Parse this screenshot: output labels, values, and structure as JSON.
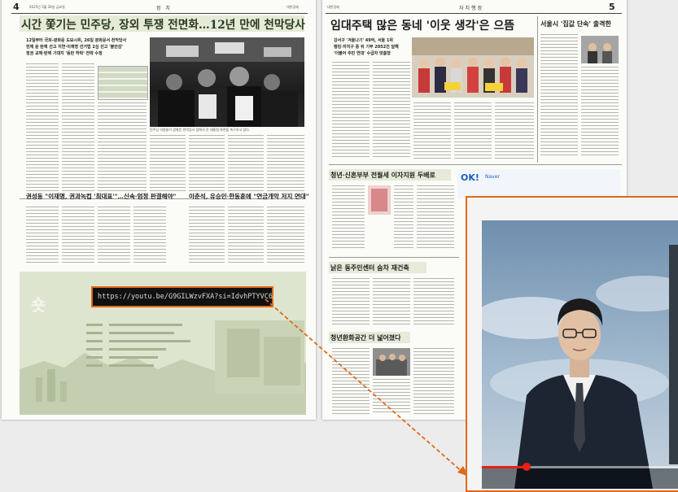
{
  "left_page": {
    "page_number": "4",
    "section": "정 치",
    "date_line": "2025년 3월 28일 금요일",
    "paper_name": "대한경제",
    "headline": "시간 쫓기는 민주당, 장외 투쟁 전면화…12년 만에 천막당사",
    "subheads": [
      "12일부터 국회-광화문 도보시위, 26일 광화문서 천막당사",
      "헌재 윤 탄핵 선고 지연·이재명 선거법 2심 선고 '불안감'",
      "정권 교체·탄핵 기대치 '동반 하락' 전략 수정"
    ],
    "photo_caption": "민주당 의원들이 광화문 천막당사 앞에서 윤 대통령 파면을 촉구하고 있다.",
    "headline2": "권성동 \"이재명, 권력 국민 가져야 할 대표다…신속·엄정 판결해야\"",
    "headline2_short": "권성동 \"이재명, 권과녹컵 '최대표'\"…신속·엄정 판결해야\"",
    "headline3": "이춘석, 유승민·한동훈에 \"연금개악 저지 연대\"",
    "url": "https://youtu.be/G9GILWzvFXA?si=IdvhPTYVC6…"
  },
  "right_page": {
    "page_number": "5",
    "section": "자치행정",
    "paper_name": "대한경제",
    "headline": "임대주택 많은 동네 '이웃 생각'은 으뜸",
    "subheads": [
      "강서구 '겨울나기' 49억, 서울 1위",
      "랭킹·자치구 중 뒤 기부 2052건 달해",
      "'더불어 주민 연대' 수급자 맞춤형"
    ],
    "side_headline": "서울시 '집값 단속' 출격한",
    "headline2": "청년·신혼부부 전월세 이자지원 두배로",
    "headline3": "낡은 동주민센터 숨차 재건축",
    "headline4": "청년환화공간 더 넓어졌다",
    "ad_logo": "OK!",
    "ad_sub": "Naver"
  },
  "video": {
    "progress": 0.22
  },
  "colors": {
    "accent": "#e06a1b",
    "green_band": "#e5ead9",
    "paper": "#fbfbf7"
  }
}
